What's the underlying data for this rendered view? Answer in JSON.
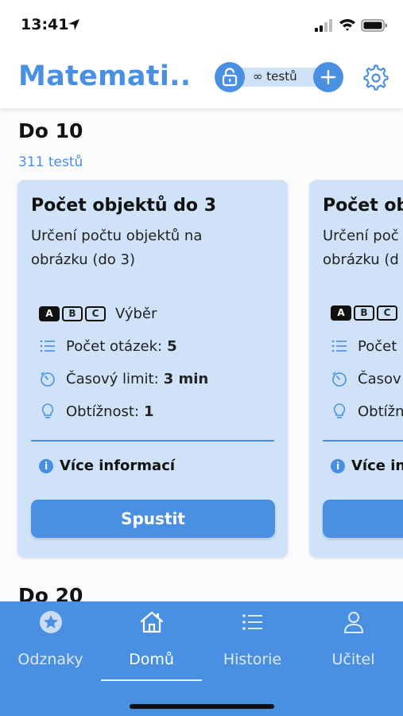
{
  "status_bar": {
    "time": "13:41",
    "icons": [
      "location-arrow-icon",
      "signal-icon",
      "wifi-icon",
      "battery-icon"
    ]
  },
  "header": {
    "title": "Matemati...",
    "tests_label": "∞ testů",
    "icons": [
      "unlock-icon",
      "plus-icon",
      "gear-icon"
    ]
  },
  "section": {
    "title": "Do 10",
    "count": "311 testů"
  },
  "next_section": {
    "title": "Do 20"
  },
  "cards": [
    {
      "title": "Počet objektů do 3",
      "description": "Určení počtu objektů na obrázku (do 3)",
      "answer_type_letters": [
        "A",
        "B",
        "C"
      ],
      "answer_type": "Výběr",
      "questions_label": "Počet otázek:",
      "questions_value": "5",
      "time_label": "Časový limit:",
      "time_value": "3 min",
      "difficulty_label": "Obtížnost:",
      "difficulty_value": "1",
      "more_info": "Více informací",
      "start_label": "Spustit"
    },
    {
      "title": "Počet ob",
      "description": "Určení poč obrázku (d",
      "answer_type_letters": [
        "A",
        "B",
        "C"
      ],
      "answer_type": "",
      "questions_label": "Počet",
      "time_label": "Časov",
      "difficulty_label": "Obtížn",
      "more_info": "Více in"
    }
  ],
  "nav": {
    "items": [
      {
        "label": "Odznaky",
        "icon": "star-badge-icon"
      },
      {
        "label": "Domů",
        "icon": "home-icon",
        "active": true
      },
      {
        "label": "Historie",
        "icon": "list-icon"
      },
      {
        "label": "Učitel",
        "icon": "person-icon"
      }
    ]
  },
  "colors": {
    "accent": "#4a90e2",
    "card_bg": "#cfe2f8",
    "text": "#111111"
  }
}
